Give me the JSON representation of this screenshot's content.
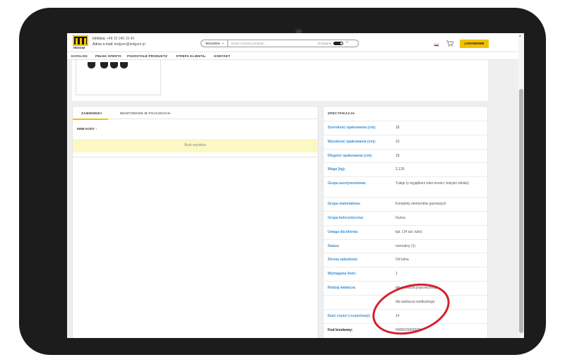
{
  "header": {
    "logo_text": "TEDGUM",
    "infoline_label": "Infolinia:",
    "infoline_value": "+48 32 240 15 43",
    "email_label": "Adres e-mail:",
    "email_value": "tedgum@tedgum.pl",
    "search_scope": "Wszystkie",
    "search_placeholder": "Wpisz szukany produkt...",
    "available_label": "Dostępne",
    "login_label": "LOGOWANIE"
  },
  "nav": [
    "KATALOG",
    "PEŁNA OFERTA",
    "POZOSTAŁE PRODUKTY",
    "STREFA KLIENTA",
    "KONTAKT"
  ],
  "tabs": {
    "replacements": "ZAMIENNIKI",
    "mounted": "MONTOWANE W POJAZDACH"
  },
  "other_codes_label": "INNE KODY ↑",
  "no_results": "Brak wyników",
  "spec": {
    "title": "SPECYFIKACJA",
    "rows": [
      {
        "key": "Szerokość opakowania (cm):",
        "value": "18"
      },
      {
        "key": "Wysokość opakowania (cm):",
        "value": "10"
      },
      {
        "key": "Długość opakowania (cm):",
        "value": "18"
      },
      {
        "key": "Waga (kg):",
        "value": "2,126"
      },
      {
        "key": "Grupa asortymentowa:",
        "value": "Tuleje (z wyjątkiem tulei mostu i kołyski silnika)"
      },
      {
        "key": "Grupa materiałowa:",
        "value": "Komplety elementów gumowych"
      },
      {
        "key": "Grupa kolorystyczna:",
        "value": "Guma"
      },
      {
        "key": "Uwaga dla klienta:",
        "value": "kpl. (14 szt. tulei)"
      },
      {
        "key": "Status:",
        "value": "normalny (1)"
      },
      {
        "key": "Strona zabudowy:",
        "value": "Od tyłna"
      },
      {
        "key": "Wymagana ilość:",
        "value": "1"
      },
      {
        "key": "Rodzaj wahacza:",
        "value": "dla wahacza poprzecznego"
      },
      {
        "key": "",
        "value": "dla wahacza wzdłużnego"
      },
      {
        "key": "Ilość części (-częściowy):",
        "value": "14"
      },
      {
        "key": "Kod kreskowy:",
        "value": "5908229999939"
      }
    ]
  },
  "colors": {
    "accent": "#f2c200",
    "link": "#3b8fd0",
    "highlight_circle": "#d61f2c",
    "no_results_bg": "#fbf8c4"
  }
}
